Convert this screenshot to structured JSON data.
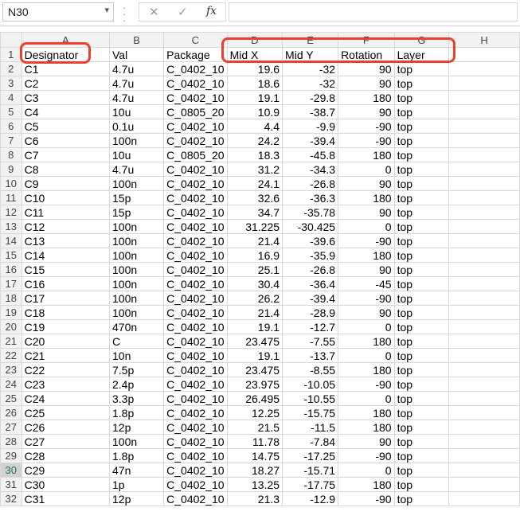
{
  "name_box": {
    "value": "N30"
  },
  "formula_bar": {
    "cancel_symbol": "✕",
    "enter_symbol": "✓",
    "fx_label": "fx",
    "value": ""
  },
  "columns": [
    "A",
    "B",
    "C",
    "D",
    "E",
    "F",
    "G",
    "H"
  ],
  "rows": [
    {
      "n": "1",
      "a": "Designator",
      "b": "Val",
      "c": "Package",
      "d": "Mid X",
      "e": "Mid Y",
      "f": "Rotation",
      "g": "Layer"
    },
    {
      "n": "2",
      "a": "C1",
      "b": "4.7u",
      "c": "C_0402_10",
      "d": "19.6",
      "e": "-32",
      "f": "90",
      "g": "top"
    },
    {
      "n": "3",
      "a": "C2",
      "b": "4.7u",
      "c": "C_0402_10",
      "d": "18.6",
      "e": "-32",
      "f": "90",
      "g": "top"
    },
    {
      "n": "4",
      "a": "C3",
      "b": "4.7u",
      "c": "C_0402_10",
      "d": "19.1",
      "e": "-29.8",
      "f": "180",
      "g": "top"
    },
    {
      "n": "5",
      "a": "C4",
      "b": "10u",
      "c": "C_0805_20",
      "d": "10.9",
      "e": "-38.7",
      "f": "90",
      "g": "top"
    },
    {
      "n": "6",
      "a": "C5",
      "b": "0.1u",
      "c": "C_0402_10",
      "d": "4.4",
      "e": "-9.9",
      "f": "-90",
      "g": "top"
    },
    {
      "n": "7",
      "a": "C6",
      "b": "100n",
      "c": "C_0402_10",
      "d": "24.2",
      "e": "-39.4",
      "f": "-90",
      "g": "top"
    },
    {
      "n": "8",
      "a": "C7",
      "b": "10u",
      "c": "C_0805_20",
      "d": "18.3",
      "e": "-45.8",
      "f": "180",
      "g": "top"
    },
    {
      "n": "9",
      "a": "C8",
      "b": "4.7u",
      "c": "C_0402_10",
      "d": "31.2",
      "e": "-34.3",
      "f": "0",
      "g": "top"
    },
    {
      "n": "10",
      "a": "C9",
      "b": "100n",
      "c": "C_0402_10",
      "d": "24.1",
      "e": "-26.8",
      "f": "90",
      "g": "top"
    },
    {
      "n": "11",
      "a": "C10",
      "b": "15p",
      "c": "C_0402_10",
      "d": "32.6",
      "e": "-36.3",
      "f": "180",
      "g": "top"
    },
    {
      "n": "12",
      "a": "C11",
      "b": "15p",
      "c": "C_0402_10",
      "d": "34.7",
      "e": "-35.78",
      "f": "90",
      "g": "top"
    },
    {
      "n": "13",
      "a": "C12",
      "b": "100n",
      "c": "C_0402_10",
      "d": "31.225",
      "e": "-30.425",
      "f": "0",
      "g": "top"
    },
    {
      "n": "14",
      "a": "C13",
      "b": "100n",
      "c": "C_0402_10",
      "d": "21.4",
      "e": "-39.6",
      "f": "-90",
      "g": "top"
    },
    {
      "n": "15",
      "a": "C14",
      "b": "100n",
      "c": "C_0402_10",
      "d": "16.9",
      "e": "-35.9",
      "f": "180",
      "g": "top"
    },
    {
      "n": "16",
      "a": "C15",
      "b": "100n",
      "c": "C_0402_10",
      "d": "25.1",
      "e": "-26.8",
      "f": "90",
      "g": "top"
    },
    {
      "n": "17",
      "a": "C16",
      "b": "100n",
      "c": "C_0402_10",
      "d": "30.4",
      "e": "-36.4",
      "f": "-45",
      "g": "top"
    },
    {
      "n": "18",
      "a": "C17",
      "b": "100n",
      "c": "C_0402_10",
      "d": "26.2",
      "e": "-39.4",
      "f": "-90",
      "g": "top"
    },
    {
      "n": "19",
      "a": "C18",
      "b": "100n",
      "c": "C_0402_10",
      "d": "21.4",
      "e": "-28.9",
      "f": "90",
      "g": "top"
    },
    {
      "n": "20",
      "a": "C19",
      "b": "470n",
      "c": "C_0402_10",
      "d": "19.1",
      "e": "-12.7",
      "f": "0",
      "g": "top"
    },
    {
      "n": "21",
      "a": "C20",
      "b": "C",
      "c": "C_0402_10",
      "d": "23.475",
      "e": "-7.55",
      "f": "180",
      "g": "top"
    },
    {
      "n": "22",
      "a": "C21",
      "b": "10n",
      "c": "C_0402_10",
      "d": "19.1",
      "e": "-13.7",
      "f": "0",
      "g": "top"
    },
    {
      "n": "23",
      "a": "C22",
      "b": "7.5p",
      "c": "C_0402_10",
      "d": "23.475",
      "e": "-8.55",
      "f": "180",
      "g": "top"
    },
    {
      "n": "24",
      "a": "C23",
      "b": "2.4p",
      "c": "C_0402_10",
      "d": "23.975",
      "e": "-10.05",
      "f": "-90",
      "g": "top"
    },
    {
      "n": "25",
      "a": "C24",
      "b": "3.3p",
      "c": "C_0402_10",
      "d": "26.495",
      "e": "-10.55",
      "f": "0",
      "g": "top"
    },
    {
      "n": "26",
      "a": "C25",
      "b": "1.8p",
      "c": "C_0402_10",
      "d": "12.25",
      "e": "-15.75",
      "f": "180",
      "g": "top"
    },
    {
      "n": "27",
      "a": "C26",
      "b": "12p",
      "c": "C_0402_10",
      "d": "21.5",
      "e": "-11.5",
      "f": "180",
      "g": "top"
    },
    {
      "n": "28",
      "a": "C27",
      "b": "100n",
      "c": "C_0402_10",
      "d": "11.78",
      "e": "-7.84",
      "f": "90",
      "g": "top"
    },
    {
      "n": "29",
      "a": "C28",
      "b": "1.8p",
      "c": "C_0402_10",
      "d": "14.75",
      "e": "-17.25",
      "f": "-90",
      "g": "top"
    },
    {
      "n": "30",
      "a": "C29",
      "b": "47n",
      "c": "C_0402_10",
      "d": "18.27",
      "e": "-15.71",
      "f": "0",
      "g": "top"
    },
    {
      "n": "31",
      "a": "C30",
      "b": "1p",
      "c": "C_0402_10",
      "d": "13.25",
      "e": "-17.75",
      "f": "180",
      "g": "top"
    },
    {
      "n": "32",
      "a": "C31",
      "b": "12p",
      "c": "C_0402_10",
      "d": "21.3",
      "e": "-12.9",
      "f": "-90",
      "g": "top"
    }
  ],
  "active_row": "30",
  "colors": {
    "annotation": "#e8412c",
    "active_row_text": "#217346"
  }
}
